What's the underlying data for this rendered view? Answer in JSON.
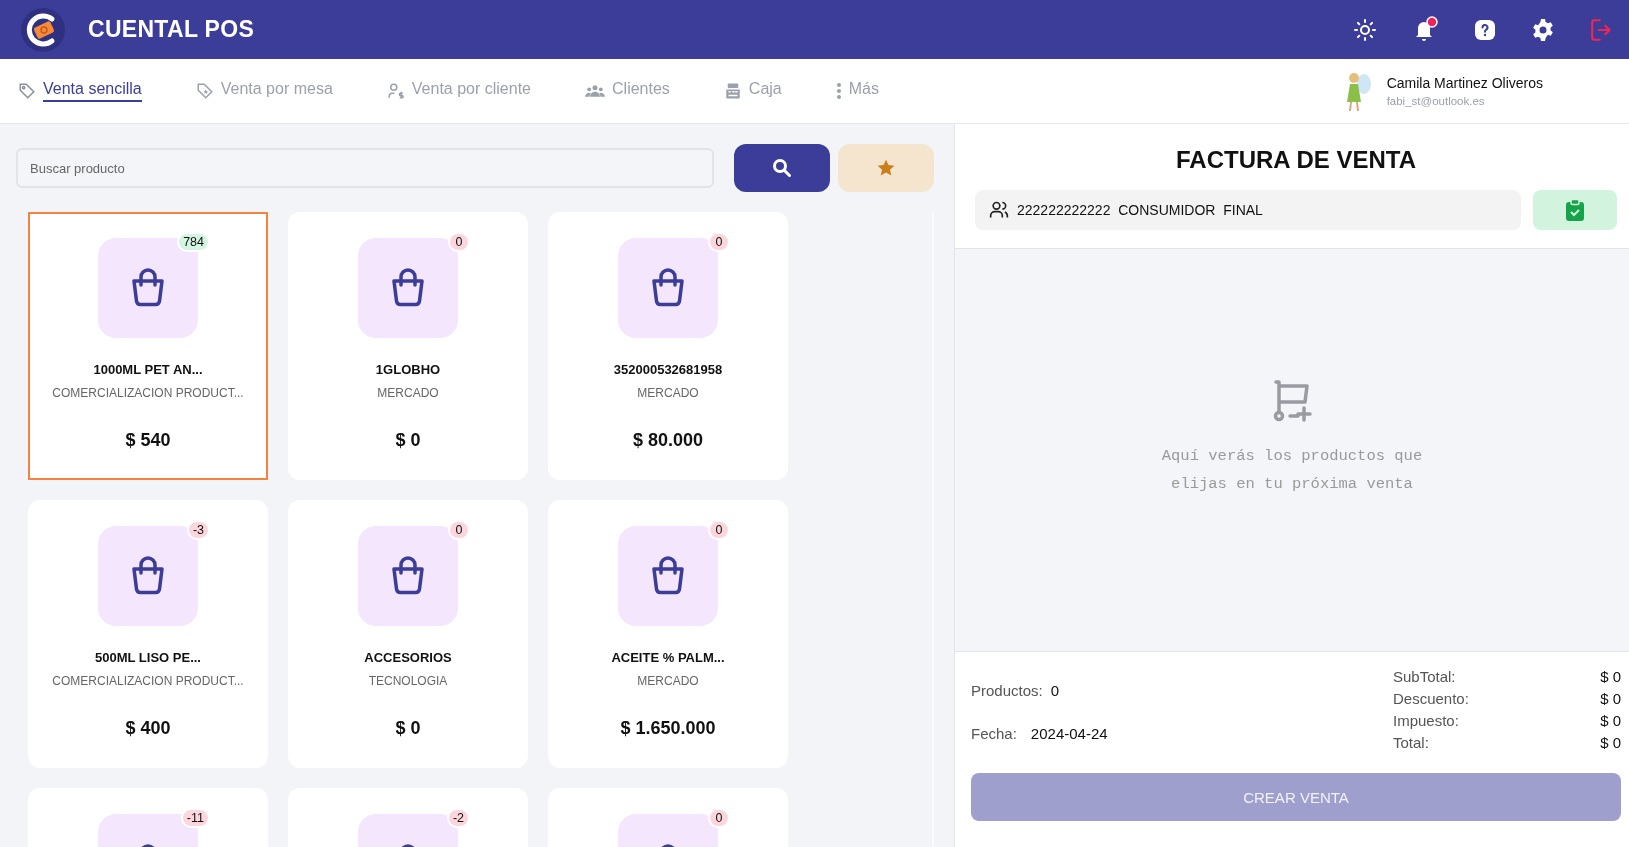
{
  "header": {
    "brand": "CUENTAL POS",
    "icons": [
      {
        "kind": "theme"
      },
      {
        "kind": "bell",
        "unread": true
      },
      {
        "kind": "help"
      },
      {
        "kind": "settings"
      },
      {
        "kind": "logout"
      }
    ]
  },
  "tabs": [
    {
      "label": "Venta sencilla",
      "selected": true
    },
    {
      "label": "Venta por mesa",
      "selected": false
    },
    {
      "label": "Venta por cliente",
      "selected": false
    },
    {
      "label": "Clientes",
      "selected": false
    },
    {
      "label": "Caja",
      "selected": false
    },
    {
      "label": "Más",
      "selected": false
    }
  ],
  "user": {
    "name": "Camila Martinez Oliveros",
    "email": "fabi_st@outlook.es"
  },
  "search": {
    "placeholder": "Buscar producto"
  },
  "products": [
    {
      "name": "1000ML PET AN...",
      "category": "COMERCIALIZACION PRODUCT...",
      "price": "$ 540",
      "stock": "784",
      "color": "#d3f5e1",
      "selected": true
    },
    {
      "name": "1GLOBHO",
      "category": "MERCADO",
      "price": "$ 0",
      "stock": "0",
      "color": "#fbd6dd",
      "selected": false
    },
    {
      "name": "352000532681958",
      "category": "MERCADO",
      "price": "$ 80.000",
      "stock": "0",
      "color": "#fbd6dd",
      "selected": false
    },
    {
      "name": "500ML LISO PE...",
      "category": "COMERCIALIZACION PRODUCT...",
      "price": "$ 400",
      "stock": "-3",
      "color": "#fbd6dd",
      "selected": false
    },
    {
      "name": "ACCESORIOS",
      "category": "TECNOLOGIA",
      "price": "$ 0",
      "stock": "0",
      "color": "#fbd6dd",
      "selected": false
    },
    {
      "name": "ACEITE % PALM...",
      "category": "MERCADO",
      "price": "$ 1.650.000",
      "stock": "0",
      "color": "#fbd6dd",
      "selected": false
    },
    {
      "stock": "-11",
      "color": "#fbd6dd",
      "selected": false
    },
    {
      "stock": "-2",
      "color": "#fbd6dd",
      "selected": false
    },
    {
      "stock": "0",
      "color": "#fbd6dd",
      "selected": false
    }
  ],
  "invoice": {
    "title": "FACTURA DE VENTA",
    "customer": "222222222222  CONSUMIDOR  FINAL",
    "empty_message": "Aquí verás los productos que elijas en tu próxima venta",
    "products_label": "Productos:",
    "products_count": "0",
    "date_label": "Fecha:",
    "date": "2024-04-24",
    "totals": [
      {
        "label": "SubTotal:",
        "value": "$ 0"
      },
      {
        "label": "Descuento:",
        "value": "$ 0"
      },
      {
        "label": "Impuesto:",
        "value": "$ 0"
      },
      {
        "label": "Total:",
        "value": "$ 0"
      }
    ],
    "submit": {
      "label": "CREAR VENTA",
      "disabled": true
    }
  }
}
